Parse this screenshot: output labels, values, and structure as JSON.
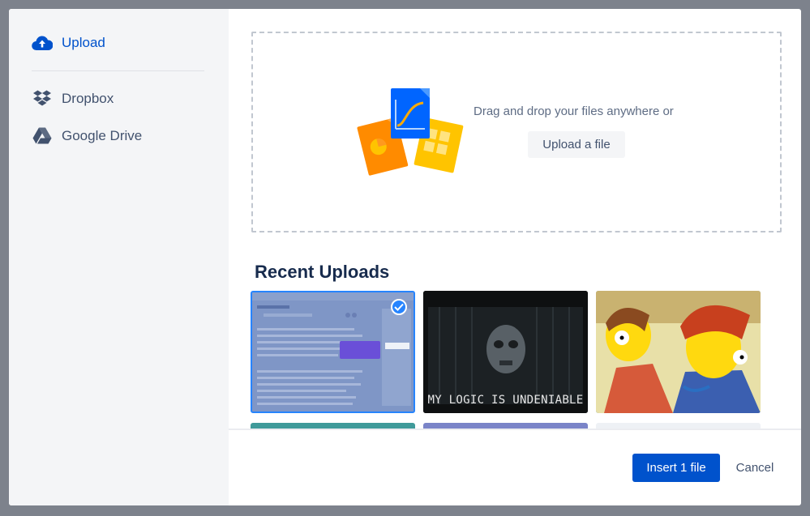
{
  "sidebar": {
    "items": [
      {
        "label": "Upload",
        "icon": "cloud-upload-icon",
        "active": true
      },
      {
        "label": "Dropbox",
        "icon": "dropbox-icon",
        "active": false
      },
      {
        "label": "Google Drive",
        "icon": "google-drive-icon",
        "active": false
      }
    ]
  },
  "dropzone": {
    "prompt": "Drag and drop your files anywhere or",
    "upload_button": "Upload a file"
  },
  "recent": {
    "title": "Recent Uploads",
    "items": [
      {
        "name": "screenshot",
        "selected": true
      },
      {
        "name": "meme",
        "caption": "MY LOGIC IS UNDENIABLE",
        "selected": false
      },
      {
        "name": "cartoon",
        "selected": false
      }
    ]
  },
  "footer": {
    "insert_button": "Insert 1 file",
    "cancel_button": "Cancel"
  },
  "colors": {
    "primary": "#0052cc",
    "selected_border": "#2684ff",
    "sidebar_bg": "#f4f5f7"
  }
}
